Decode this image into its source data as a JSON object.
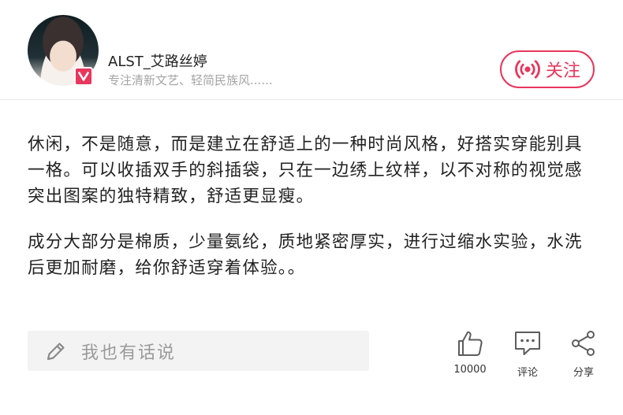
{
  "author": {
    "name": "ALST_艾路丝婷",
    "bio": "专注清新文艺、轻简民族风......"
  },
  "follow": {
    "label": "关注"
  },
  "article": {
    "paragraphs": [
      "休闲，不是随意，而是建立在舒适上的一种时尚风格，好搭实穿能别具一格。可以收插双手的斜插袋，只在一边绣上纹样，以不对称的视觉感突出图案的独特精致，舒适更显瘦。",
      "成分大部分是棉质，少量氨纶，质地紧密厚实，进行过缩水实验，水洗后更加耐磨，给你舒适穿着体验。。"
    ]
  },
  "footer": {
    "comment_placeholder": "我也有话说",
    "like_count": "10000",
    "comment_label": "评论",
    "share_label": "分享"
  },
  "colors": {
    "accent": "#e8365c",
    "muted_text": "#a4a4a4",
    "input_bg": "#f3f3f3"
  },
  "icons": {
    "badge": "vip-v-icon",
    "follow": "live-broadcast-icon",
    "comment_box": "pencil-icon",
    "like": "thumbs-up-icon",
    "comment": "comment-bubble-icon",
    "share": "share-icon"
  }
}
